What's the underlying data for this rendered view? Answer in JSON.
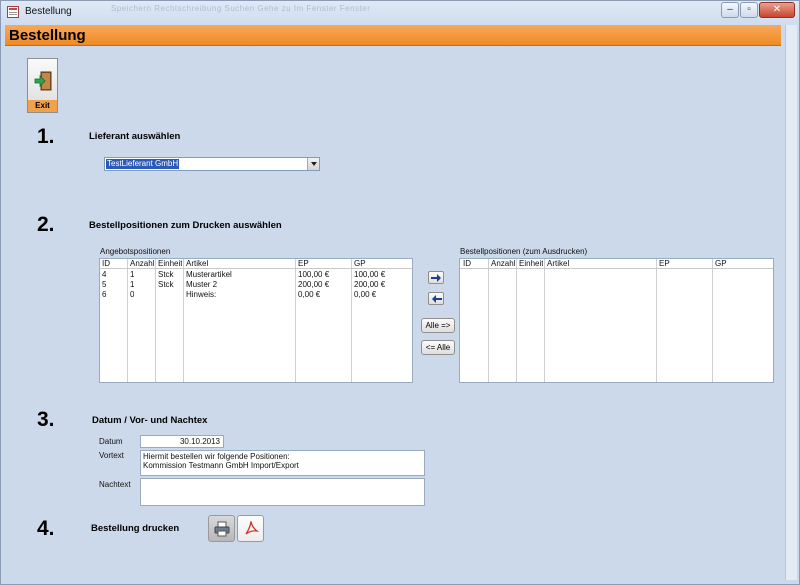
{
  "window": {
    "title": "Bestellung"
  },
  "ribbon_ghost": "Speichern   Rechtschreibung   Suchen   Gehe zu   Im Fenster   Fenster",
  "form": {
    "title": "Bestellung"
  },
  "exit_button": {
    "label": "Exit",
    "icon": "exit-door-icon"
  },
  "steps": {
    "step1": {
      "number": "1.",
      "label": "Lieferant auswählen"
    },
    "step2": {
      "number": "2.",
      "label": "Bestellpositionen zum Drucken auswählen"
    },
    "step3": {
      "number": "3.",
      "label": "Datum / Vor- und Nachtex"
    },
    "step4": {
      "number": "4.",
      "label": "Bestellung drucken"
    }
  },
  "supplier": {
    "value": "TestLieferant GmbH"
  },
  "offer_list": {
    "label": "Angebotspositionen",
    "columns": [
      "ID",
      "Anzahl",
      "Einheit",
      "Artikel",
      "EP",
      "GP"
    ],
    "rows": [
      [
        "4",
        "1",
        "Stck",
        "Musterartikel",
        "100,00 €",
        "100,00 €"
      ],
      [
        "5",
        "1",
        "Stck",
        "Muster 2",
        "200,00 €",
        "200,00 €"
      ],
      [
        "6",
        "0",
        "",
        "Hinweis:",
        "0,00 €",
        "0,00 €"
      ]
    ]
  },
  "order_list": {
    "label": "Bestellpositionen (zum Ausdrucken)",
    "columns": [
      "ID",
      "Anzahl",
      "Einheit",
      "Artikel",
      "EP",
      "GP"
    ],
    "rows": []
  },
  "buttons": {
    "move_right_icon": "arrow-right-icon",
    "move_left_icon": "arrow-left-icon",
    "all_right": "Alle =>",
    "all_left": "<= Alle",
    "print_icon": "printer-icon",
    "pdf_icon": "pdf-icon"
  },
  "fields": {
    "date_label": "Datum",
    "date_value": "30.10.2013",
    "vortext_label": "Vortext",
    "vortext_lines": [
      "Hiermit bestellen wir folgende Positionen:",
      "Kommission Testmann GmbH Import/Export"
    ],
    "nachtext_label": "Nachtext",
    "nachtext_value": ""
  },
  "colors": {
    "accent": "#f39a3a",
    "background": "#ccd9ea",
    "selection": "#2d5ab8"
  }
}
